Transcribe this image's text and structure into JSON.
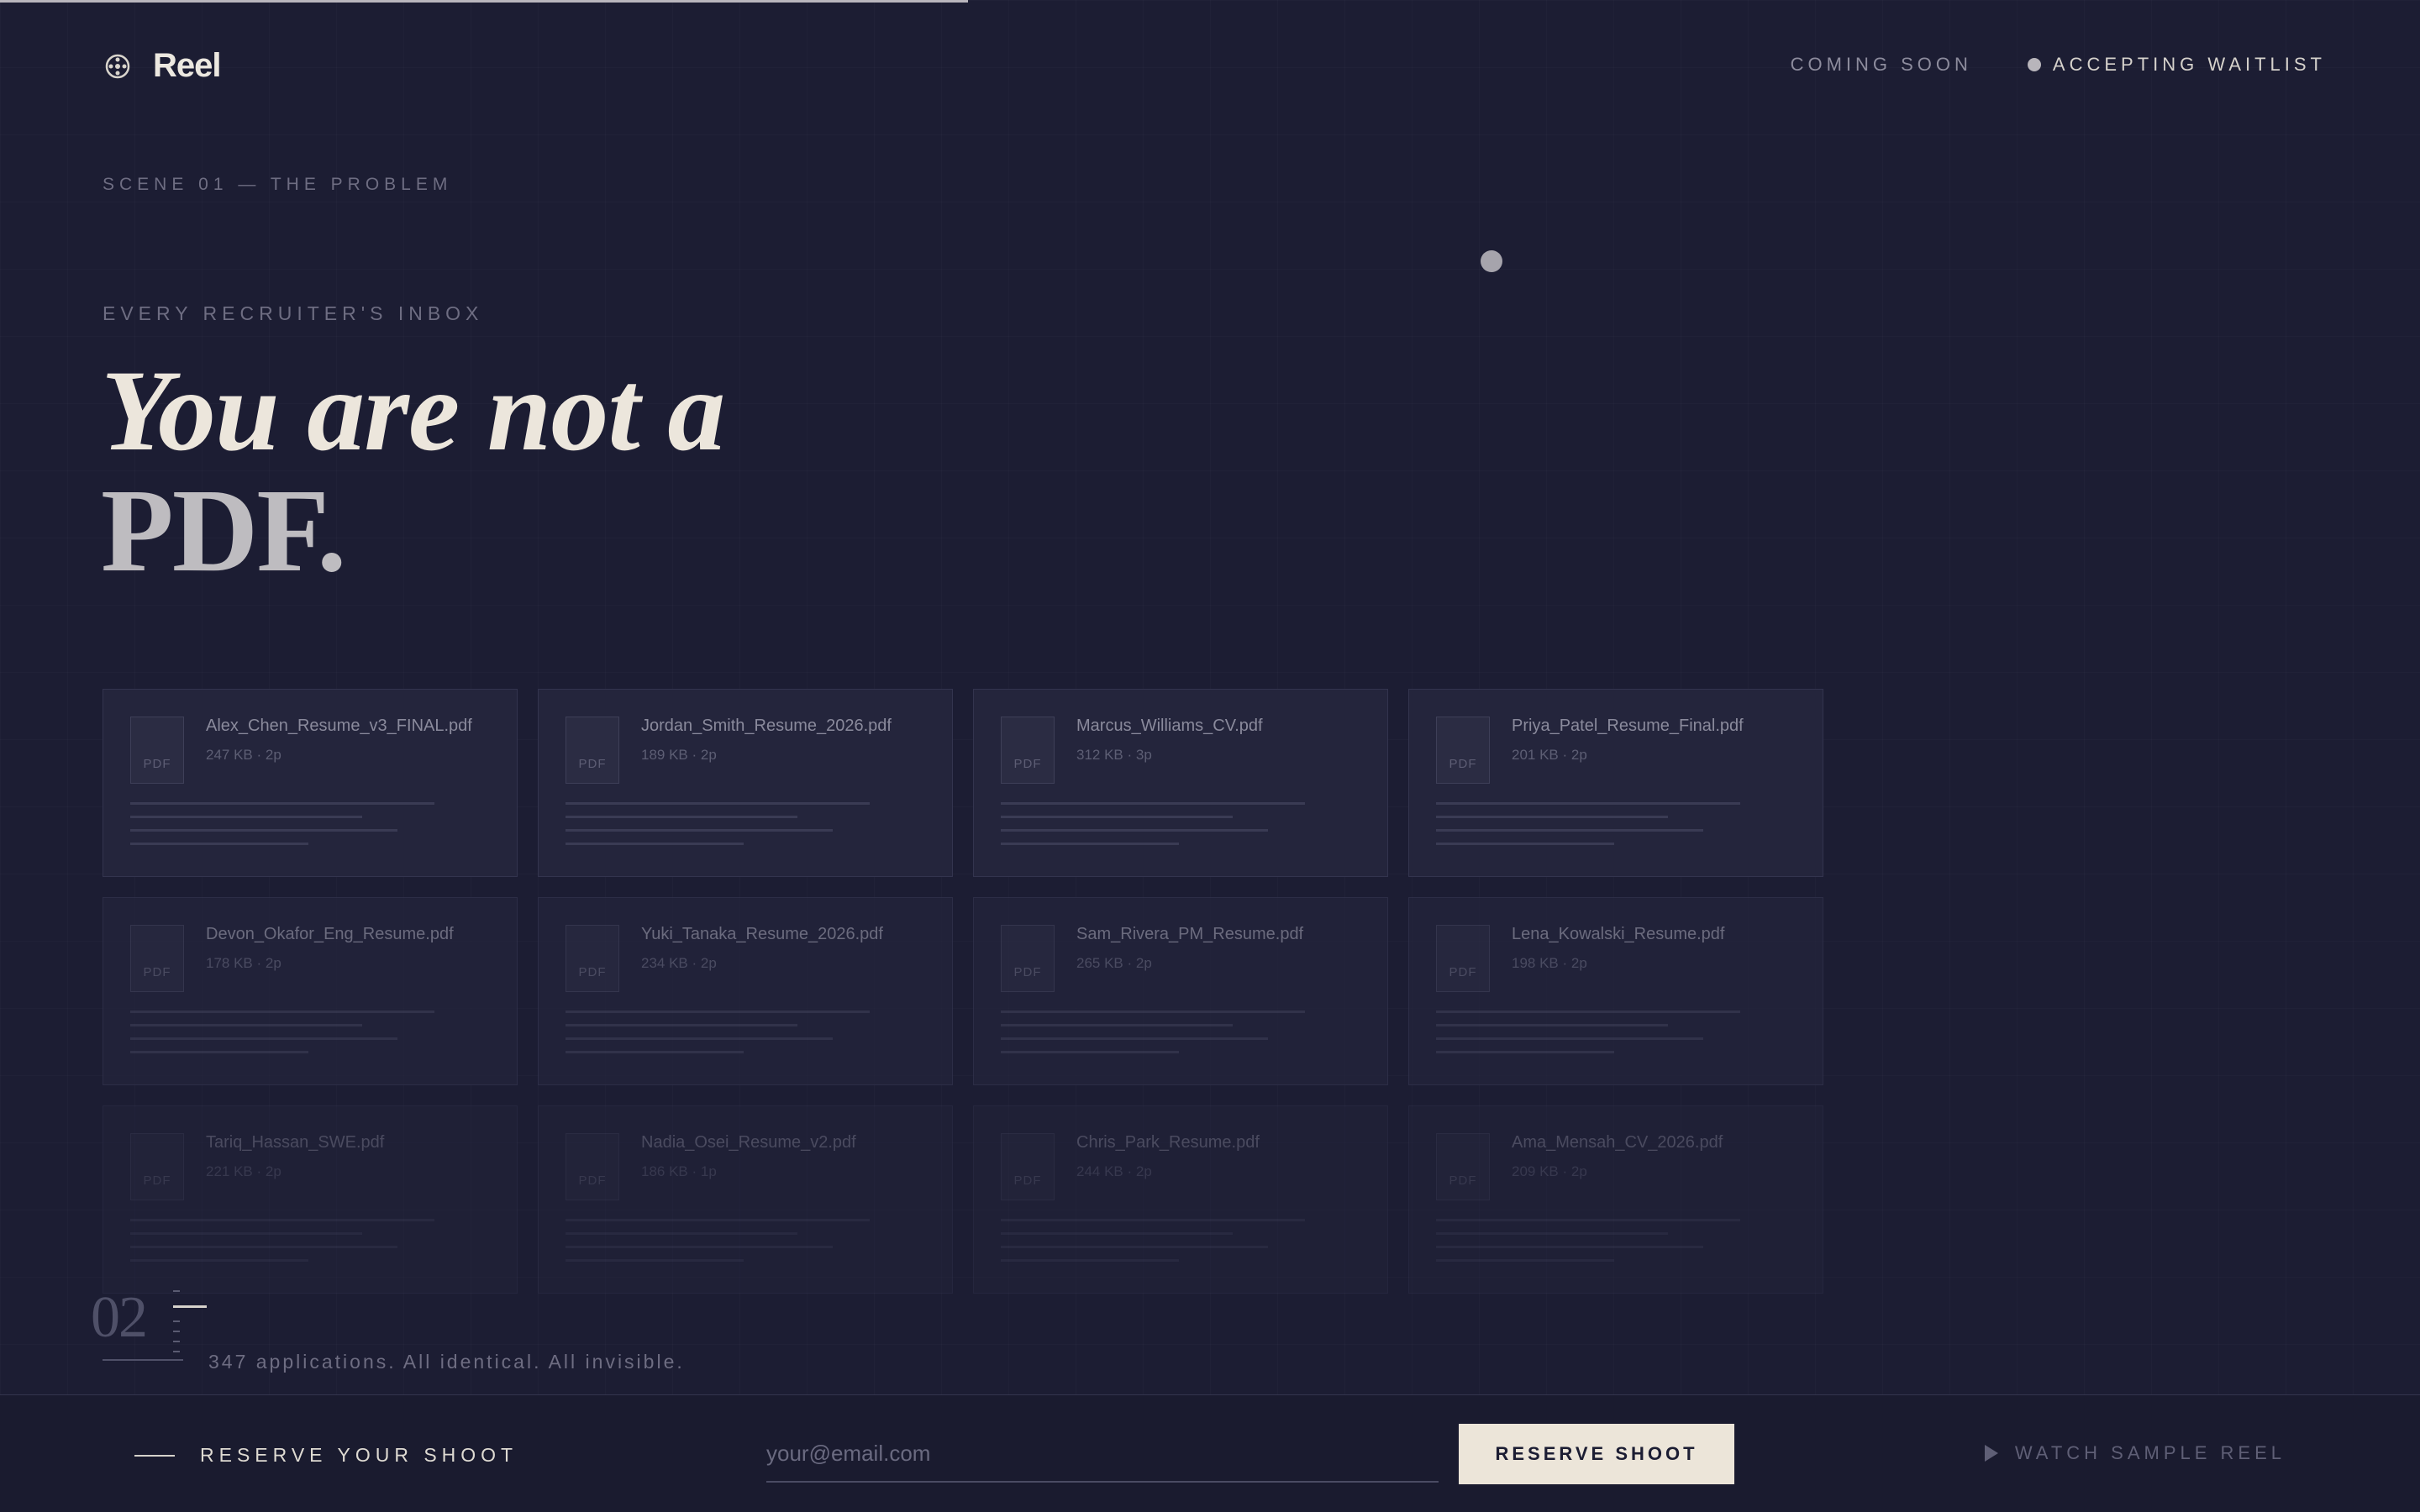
{
  "header": {
    "brand": "Reel",
    "coming_soon": "COMING SOON",
    "waitlist": "ACCEPTING WAITLIST"
  },
  "scene": {
    "label": "SCENE 01 — THE PROBLEM",
    "eyebrow": "EVERY RECRUITER'S INBOX",
    "headline_line1": "You are not a",
    "headline_line2": "PDF."
  },
  "files": [
    {
      "name": "Alex_Chen_Resume_v3_FINAL.pdf",
      "meta": "247 KB · 2p",
      "icon_label": "PDF"
    },
    {
      "name": "Jordan_Smith_Resume_2026.pdf",
      "meta": "189 KB · 2p",
      "icon_label": "PDF"
    },
    {
      "name": "Marcus_Williams_CV.pdf",
      "meta": "312 KB · 3p",
      "icon_label": "PDF"
    },
    {
      "name": "Priya_Patel_Resume_Final.pdf",
      "meta": "201 KB · 2p",
      "icon_label": "PDF"
    },
    {
      "name": "Devon_Okafor_Eng_Resume.pdf",
      "meta": "178 KB · 2p",
      "icon_label": "PDF"
    },
    {
      "name": "Yuki_Tanaka_Resume_2026.pdf",
      "meta": "234 KB · 2p",
      "icon_label": "PDF"
    },
    {
      "name": "Sam_Rivera_PM_Resume.pdf",
      "meta": "265 KB · 2p",
      "icon_label": "PDF"
    },
    {
      "name": "Lena_Kowalski_Resume.pdf",
      "meta": "198 KB · 2p",
      "icon_label": "PDF"
    },
    {
      "name": "Tariq_Hassan_SWE.pdf",
      "meta": "221 KB · 2p",
      "icon_label": "PDF"
    },
    {
      "name": "Nadia_Osei_Resume_v2.pdf",
      "meta": "186 KB · 1p",
      "icon_label": "PDF"
    },
    {
      "name": "Chris_Park_Resume.pdf",
      "meta": "244 KB · 2p",
      "icon_label": "PDF"
    },
    {
      "name": "Ama_Mensah_CV_2026.pdf",
      "meta": "209 KB · 2p",
      "icon_label": "PDF"
    }
  ],
  "counter": {
    "number": "02",
    "caption": "347 applications. All identical. All invisible."
  },
  "footer": {
    "reserve_label": "RESERVE YOUR SHOOT",
    "email_placeholder": "your@email.com",
    "email_value": "",
    "reserve_button": "RESERVE SHOOT",
    "watch_link": "WATCH SAMPLE REEL"
  },
  "progress": 0.4,
  "colors": {
    "background": "#1c1d33",
    "accent_button": "#ece5d9",
    "headline": "#ece6dc"
  }
}
